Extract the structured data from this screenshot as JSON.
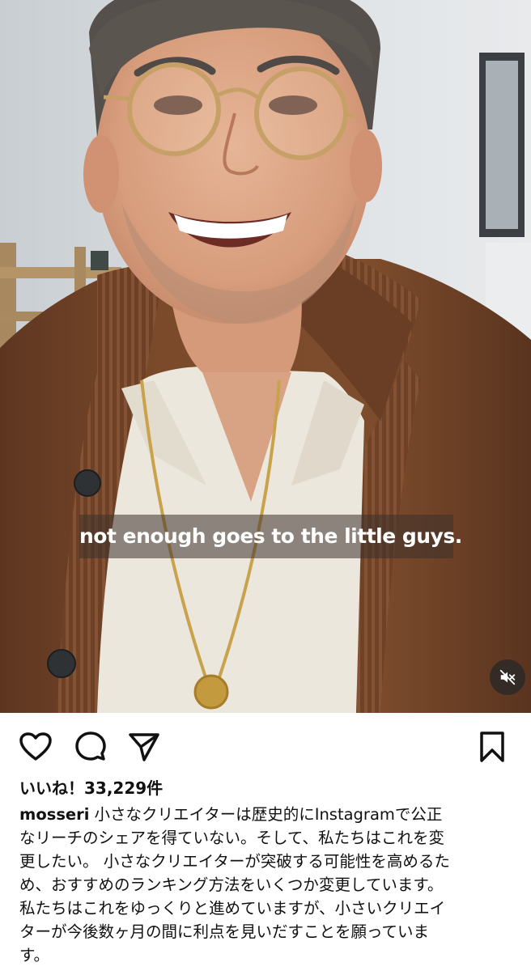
{
  "video": {
    "subtitle": "not enough goes to the little guys.",
    "mute_icon": "speaker-muted-icon"
  },
  "actions": {
    "like_icon": "heart-icon",
    "comment_icon": "comment-bubble-icon",
    "share_icon": "paper-plane-icon",
    "save_icon": "bookmark-icon"
  },
  "post": {
    "likes_text": "いいね！33,229件",
    "username": "mosseri",
    "caption_lines": [
      "小さなクリエイターは歴史的にInstagramで公正",
      "なリーチのシェアを得ていない。そして、私たちはこれを変",
      "更したい。 小さなクリエイターが突破する可能性を高めるた",
      "め、おすすめのランキング方法をいくつか変更しています。",
      "私たちはこれをゆっくりと進めていますが、小さいクリエイ",
      "ターが今後数ヶ月の間に利点を見いだすことを願っていま",
      "す。"
    ]
  },
  "colors": {
    "cardigan": "#7a4a2b",
    "shirt": "#ece7dd",
    "background": "#d9dde0",
    "text": "#111111"
  }
}
